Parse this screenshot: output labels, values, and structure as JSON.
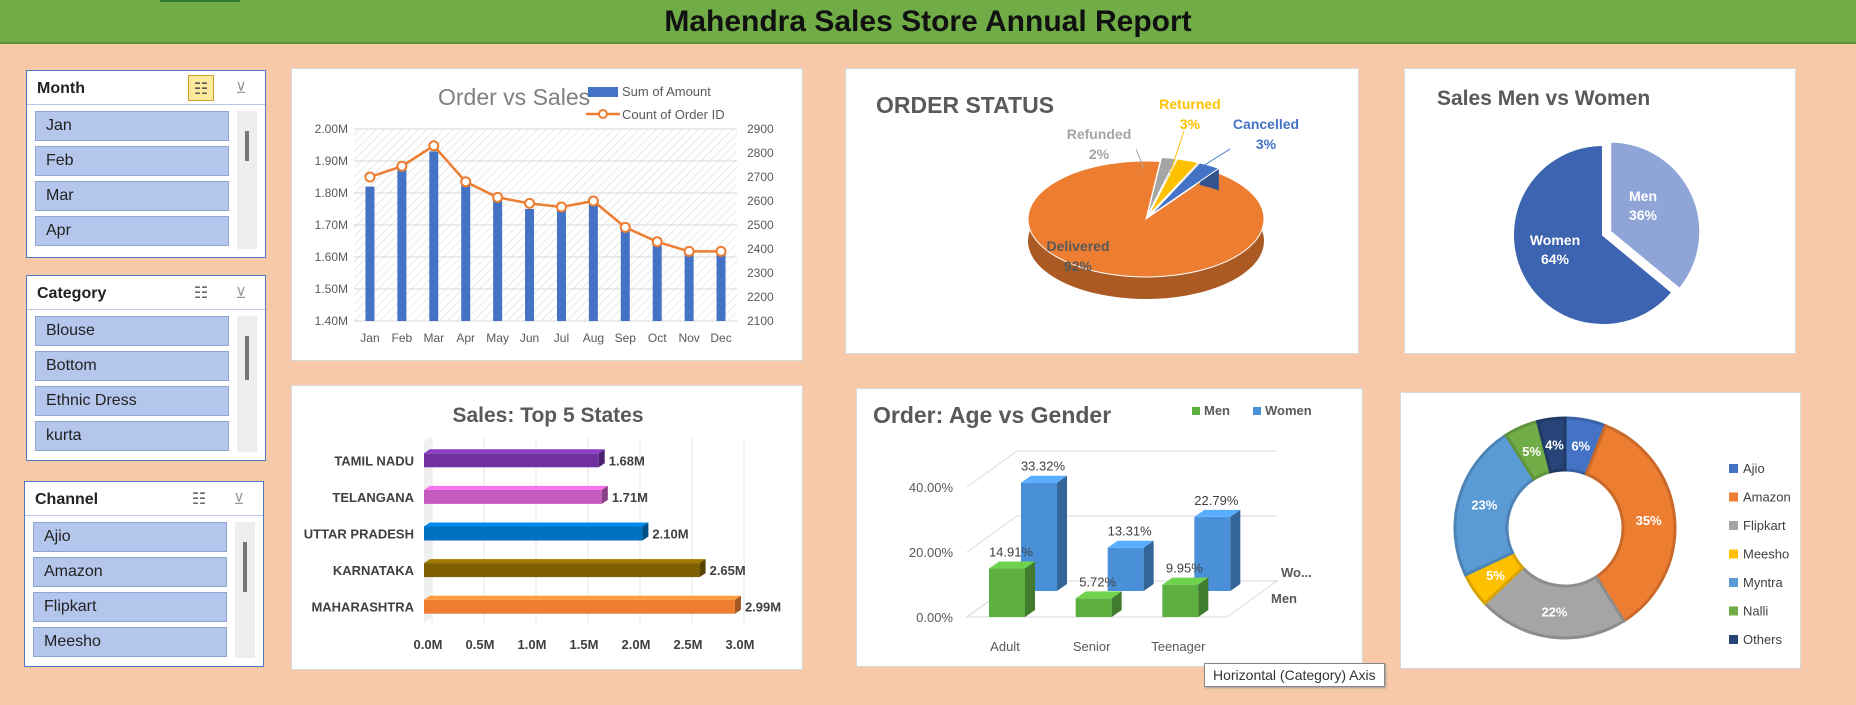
{
  "header": {
    "title": "Mahendra Sales Store Annual Report"
  },
  "slicers": {
    "month": {
      "title": "Month",
      "items": [
        "Jan",
        "Feb",
        "Mar",
        "Apr"
      ]
    },
    "category": {
      "title": "Category",
      "items": [
        "Blouse",
        "Bottom",
        "Ethnic Dress",
        "kurta"
      ]
    },
    "channel": {
      "title": "Channel",
      "items": [
        "Ajio",
        "Amazon",
        "Flipkart",
        "Meesho"
      ]
    }
  },
  "icons": {
    "multiselect": "multi-select-icon",
    "clear_filter": "clear-filter-icon"
  },
  "colors": {
    "header_bg": "#70ad47",
    "page_bg": "#f8c9a8",
    "bar_blue": "#4472c4",
    "line_orange": "#ed7d31"
  },
  "tooltip": "Horizontal (Category) Axis",
  "chart_data": [
    {
      "type": "bar+line",
      "title": "Order vs Sales",
      "categories": [
        "Jan",
        "Feb",
        "Mar",
        "Apr",
        "May",
        "Jun",
        "Jul",
        "Aug",
        "Sep",
        "Oct",
        "Nov",
        "Dec"
      ],
      "series": [
        {
          "name": "Sum of Amount",
          "kind": "bar",
          "axis": "left",
          "values": [
            1.82,
            1.88,
            1.93,
            1.83,
            1.78,
            1.75,
            1.75,
            1.78,
            1.69,
            1.66,
            1.61,
            1.61
          ]
        },
        {
          "name": "Count of Order ID",
          "kind": "line",
          "axis": "right",
          "values": [
            2700,
            2745,
            2830,
            2680,
            2615,
            2590,
            2575,
            2600,
            2490,
            2430,
            2390,
            2390
          ]
        }
      ],
      "ylim_left": [
        1.4,
        2.0
      ],
      "ylim_right": [
        2100,
        2900
      ],
      "left_ticks": [
        "1.40M",
        "1.50M",
        "1.60M",
        "1.70M",
        "1.80M",
        "1.90M",
        "2.00M"
      ],
      "right_ticks": [
        "2100",
        "2200",
        "2300",
        "2400",
        "2500",
        "2600",
        "2700",
        "2800",
        "2900"
      ],
      "legend": "top-right"
    },
    {
      "type": "pie",
      "title": "ORDER STATUS",
      "slices": [
        {
          "label": "Delivered",
          "value": 92,
          "text": "92%",
          "color": "#ed7d31"
        },
        {
          "label": "Refunded",
          "value": 2,
          "text": "2%",
          "color": "#a5a5a5"
        },
        {
          "label": "Returned",
          "value": 3,
          "text": "3%",
          "color": "#ffc000"
        },
        {
          "label": "Cancelled",
          "value": 3,
          "text": "3%",
          "color": "#4472c4"
        }
      ]
    },
    {
      "type": "pie",
      "title": "Sales Men vs Women",
      "slices": [
        {
          "label": "Women",
          "value": 64,
          "text": "64%",
          "color": "#3c64b1"
        },
        {
          "label": "Men",
          "value": 36,
          "text": "36%",
          "color": "#8fa5d8"
        }
      ]
    },
    {
      "type": "bar",
      "title": "Sales: Top 5 States",
      "categories": [
        "TAMIL NADU",
        "TELANGANA",
        "UTTAR PRADESH",
        "KARNATAKA",
        "MAHARASHTRA"
      ],
      "values": [
        1.68,
        1.71,
        2.1,
        2.65,
        2.99
      ],
      "value_labels": [
        "1.68M",
        "1.71M",
        "2.10M",
        "2.65M",
        "2.99M"
      ],
      "colors": [
        "#7030a0",
        "#c55bbe",
        "#0070c0",
        "#7f6000",
        "#ed7d31"
      ],
      "xlim": [
        0,
        3.0
      ],
      "x_ticks": [
        "0.0M",
        "0.5M",
        "1.0M",
        "1.5M",
        "2.0M",
        "2.5M",
        "3.0M"
      ]
    },
    {
      "type": "bar",
      "title": "Order: Age vs Gender",
      "categories": [
        "Adult",
        "Senior",
        "Teenager"
      ],
      "series": [
        {
          "name": "Men",
          "values": [
            14.91,
            5.72,
            9.95
          ],
          "labels": [
            "14.91%",
            "5.72%",
            "9.95%"
          ],
          "color": "#5db040"
        },
        {
          "name": "Women",
          "values": [
            33.32,
            13.31,
            22.79
          ],
          "labels": [
            "33.32%",
            "13.31%",
            "22.79%"
          ],
          "color": "#4a90d9"
        }
      ],
      "ylim": [
        0,
        40
      ],
      "y_ticks": [
        "0.00%",
        "20.00%",
        "40.00%"
      ],
      "depth_labels": [
        "Men",
        "Wo..."
      ],
      "legend": "top-right"
    },
    {
      "type": "pie",
      "variant": "donut",
      "title": "",
      "slices": [
        {
          "label": "Ajio",
          "value": 6,
          "text": "6%",
          "color": "#4472c4"
        },
        {
          "label": "Amazon",
          "value": 35,
          "text": "35%",
          "color": "#ed7d31"
        },
        {
          "label": "Flipkart",
          "value": 22,
          "text": "22%",
          "color": "#a5a5a5"
        },
        {
          "label": "Meesho",
          "value": 5,
          "text": "5%",
          "color": "#ffc000"
        },
        {
          "label": "Myntra",
          "value": 23,
          "text": "23%",
          "color": "#5b9bd5"
        },
        {
          "label": "Nalli",
          "value": 5,
          "text": "5%",
          "color": "#70ad47"
        },
        {
          "label": "Others",
          "value": 4,
          "text": "4%",
          "color": "#264478"
        }
      ],
      "legend": "right"
    }
  ]
}
